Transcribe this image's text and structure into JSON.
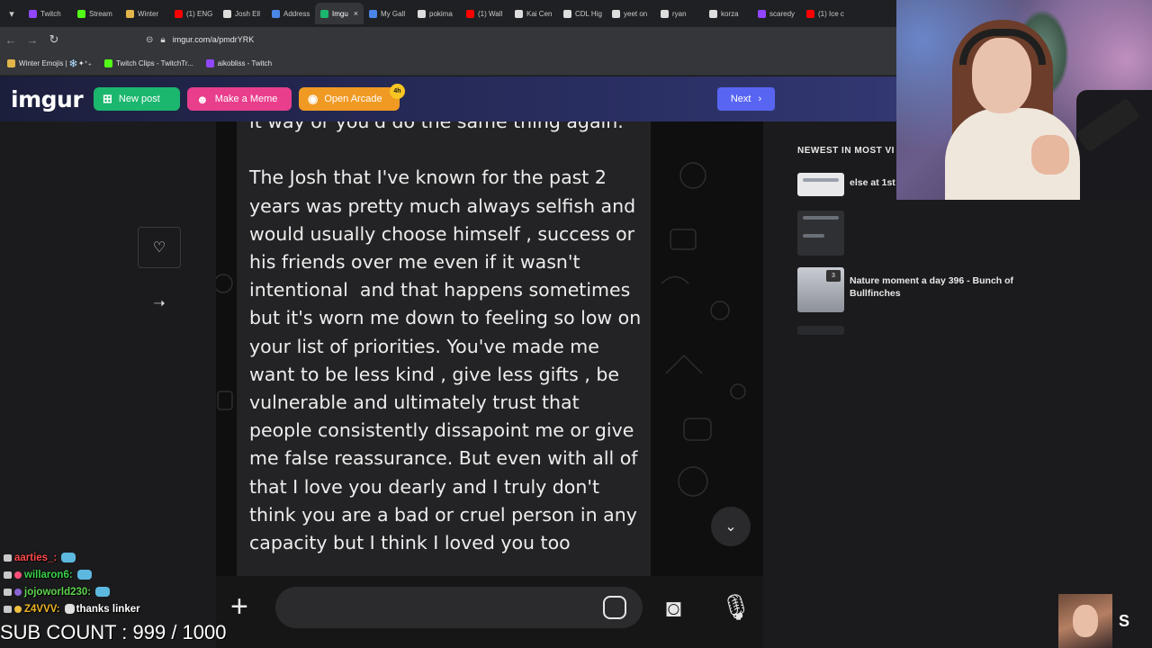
{
  "browser": {
    "tabs": [
      {
        "label": "Twitch",
        "color": "#9146ff",
        "active": false
      },
      {
        "label": "Stream",
        "color": "#53fc18",
        "active": false
      },
      {
        "label": "Winter",
        "color": "#e2b54a",
        "active": false
      },
      {
        "label": "(1) ENG",
        "color": "#ff0000",
        "active": false
      },
      {
        "label": "Josh Ell",
        "color": "#dddddd",
        "active": false
      },
      {
        "label": "Address",
        "color": "#4a86e8",
        "active": false
      },
      {
        "label": "Imgu",
        "color": "#1bb76e",
        "active": true
      },
      {
        "label": "My Gall",
        "color": "#4a86e8",
        "active": false
      },
      {
        "label": "pokima",
        "color": "#dddddd",
        "active": false
      },
      {
        "label": "(1) Wall",
        "color": "#ff0000",
        "active": false
      },
      {
        "label": "Kai Cen",
        "color": "#dddddd",
        "active": false
      },
      {
        "label": "CDL Hig",
        "color": "#dddddd",
        "active": false
      },
      {
        "label": "yeet on",
        "color": "#dddddd",
        "active": false
      },
      {
        "label": "ryan",
        "color": "#dddddd",
        "active": false
      },
      {
        "label": "korza",
        "color": "#dddddd",
        "active": false
      },
      {
        "label": "scaredy",
        "color": "#9146ff",
        "active": false
      },
      {
        "label": "(1) Ice c",
        "color": "#ff0000",
        "active": false
      }
    ],
    "url": "imgur.com/a/pmdrYRK",
    "bookmarks": [
      {
        "label": "Winter Emojis | ❄️✦⁺₊",
        "color": "#e2b54a"
      },
      {
        "label": "Twitch Clips - TwitchTr...",
        "color": "#53fc18"
      },
      {
        "label": "aikobliss - Twitch",
        "color": "#9146ff"
      }
    ]
  },
  "imgur": {
    "logo": "imgur",
    "new_post": "New post",
    "make_meme": "Make a Meme",
    "open_arcade": "Open Arcade",
    "arcade_badge": "4h",
    "next": "Next"
  },
  "post": {
    "message": "it way or you'd do the same thing again.\n\nThe Josh that I've known for the past 2 years was pretty much always selfish and would usually choose himself , success or his friends over me even if it wasn't intentional  and that happens sometimes but it's worn me down to feeling so low on your list of priorities. You've made me want to be less kind , give less gifts , be vulnerable and ultimately trust that people consistently dissapoint me or give me false reassurance. But even with all of that I love you dearly and I truly don't think you are a bad or cruel person in any capacity but I think I loved you too"
  },
  "rail": {
    "heading": "NEWEST IN MOST VI",
    "items": [
      {
        "title": "else at 1st",
        "count": ""
      },
      {
        "title": "",
        "count": ""
      },
      {
        "title": "Nature moment a day 396 - Bunch of Bullfinches",
        "count": "3"
      }
    ]
  },
  "chat": [
    {
      "user": "aarties_:",
      "user_color": "#ff4a4a",
      "message": "",
      "badge_color": "#ff6b6b"
    },
    {
      "user": "willaron6:",
      "user_color": "#3ad14a",
      "message": "",
      "badge_color": "#ff4f7a"
    },
    {
      "user": "jojoworld230:",
      "user_color": "#5fd34f",
      "message": "",
      "badge_color": "#8a63d2"
    },
    {
      "user": "Z4VVV:",
      "user_color": "#f0b626",
      "message": "thanks linker",
      "badge_color": "#f0c040"
    }
  ],
  "stream": {
    "sub_count": "SUB COUNT : 999 / 1000"
  }
}
